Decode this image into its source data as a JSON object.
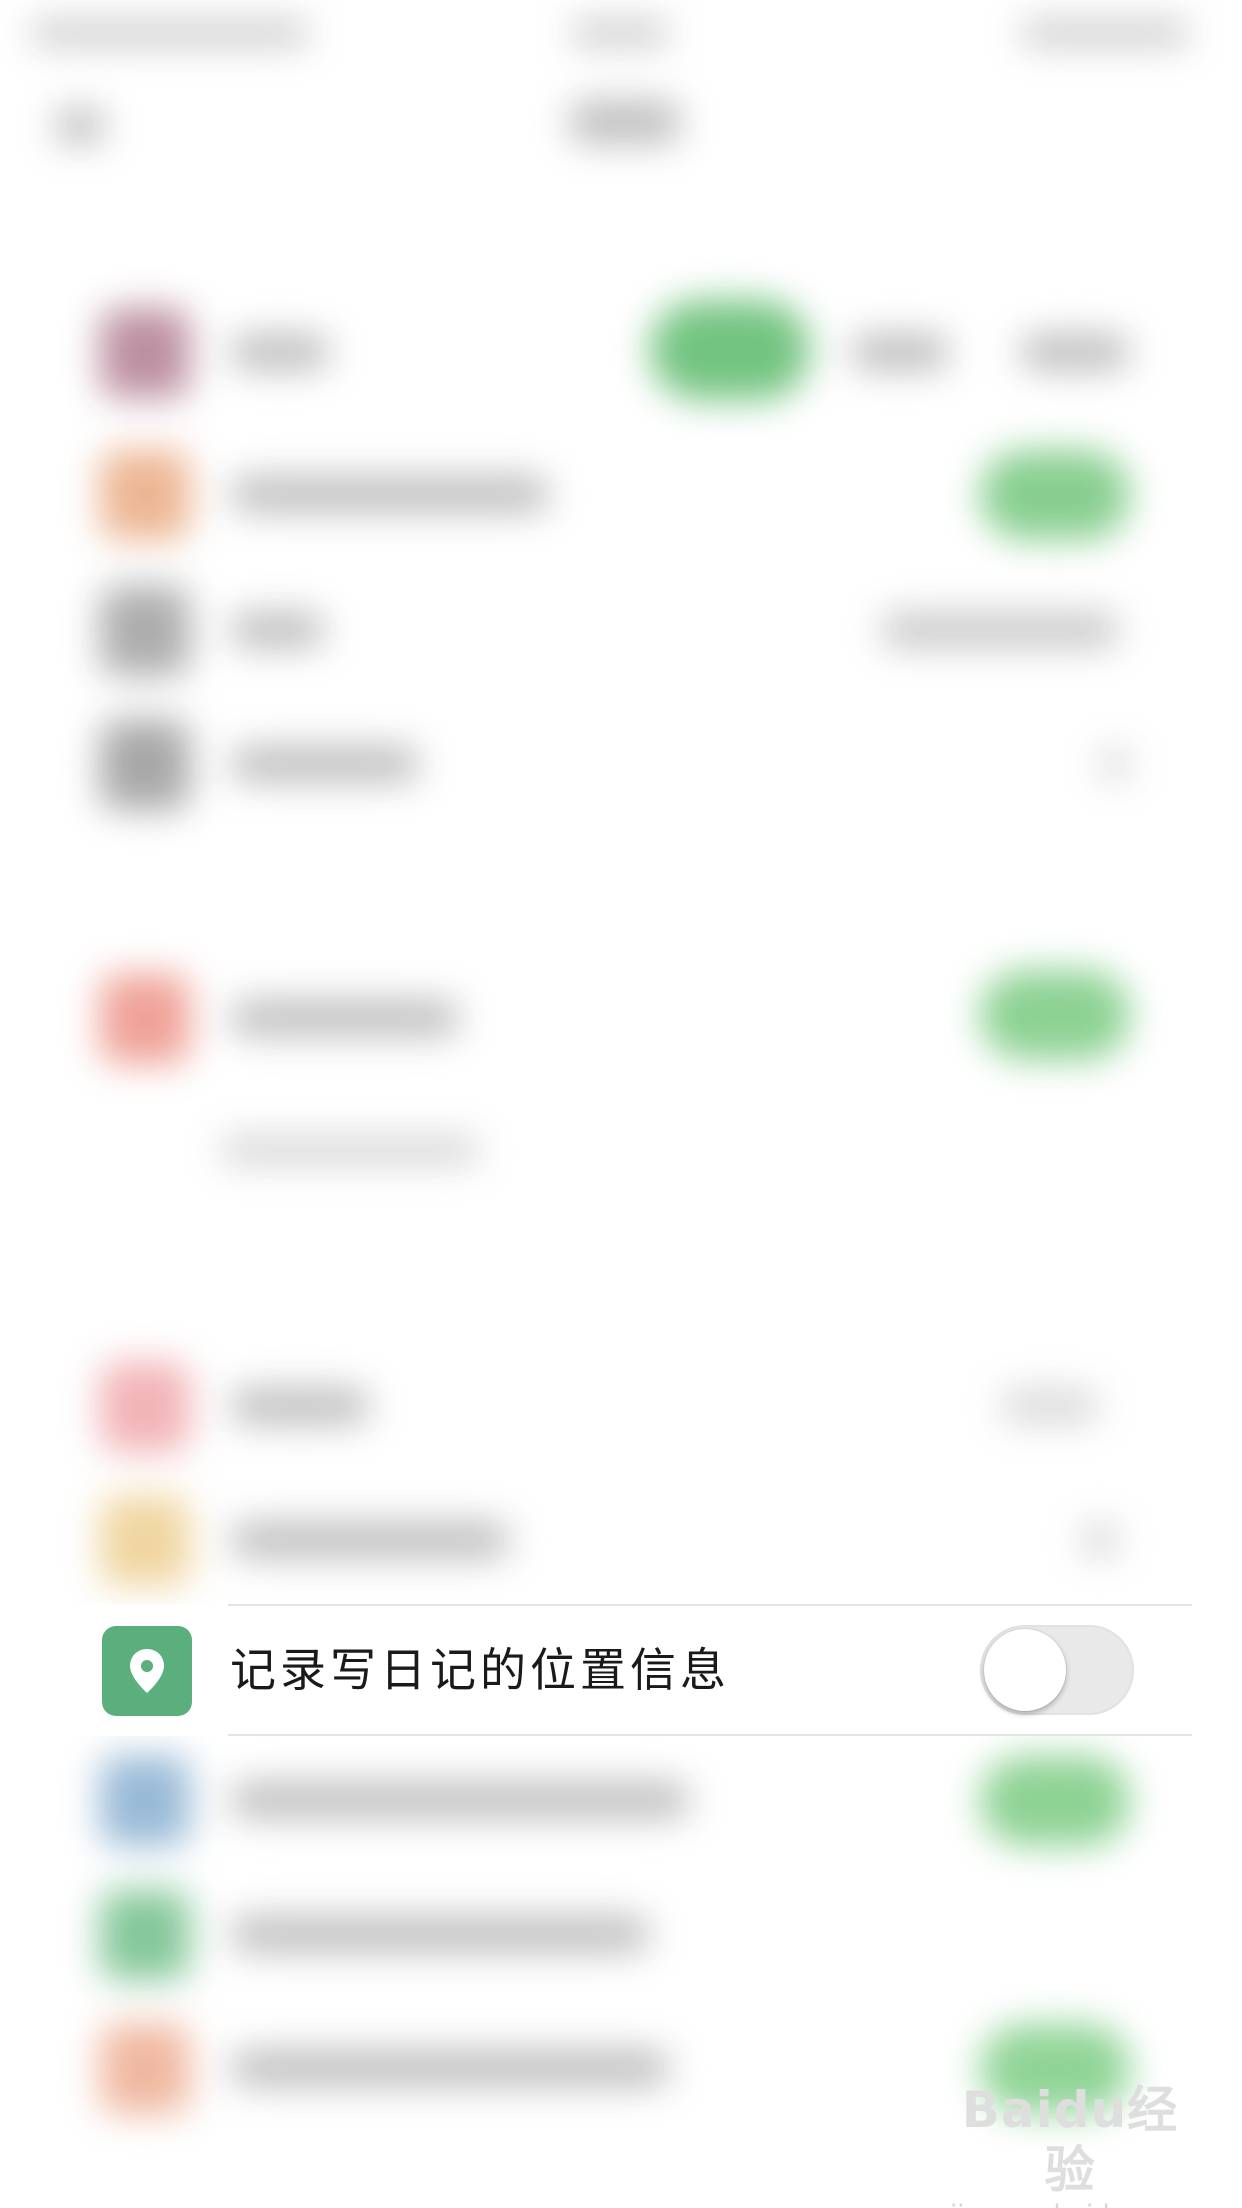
{
  "settings_row": {
    "label": "记录写日记的位置信息",
    "icon": "location-pin-icon",
    "icon_color": "#5aaf7d",
    "toggle_on": false
  },
  "watermark": {
    "brand": "Baidu经验",
    "url": "jingyan.baidu.com"
  },
  "colors": {
    "toggle_off_track": "#e9e9ea",
    "divider": "#e4e4e4"
  }
}
